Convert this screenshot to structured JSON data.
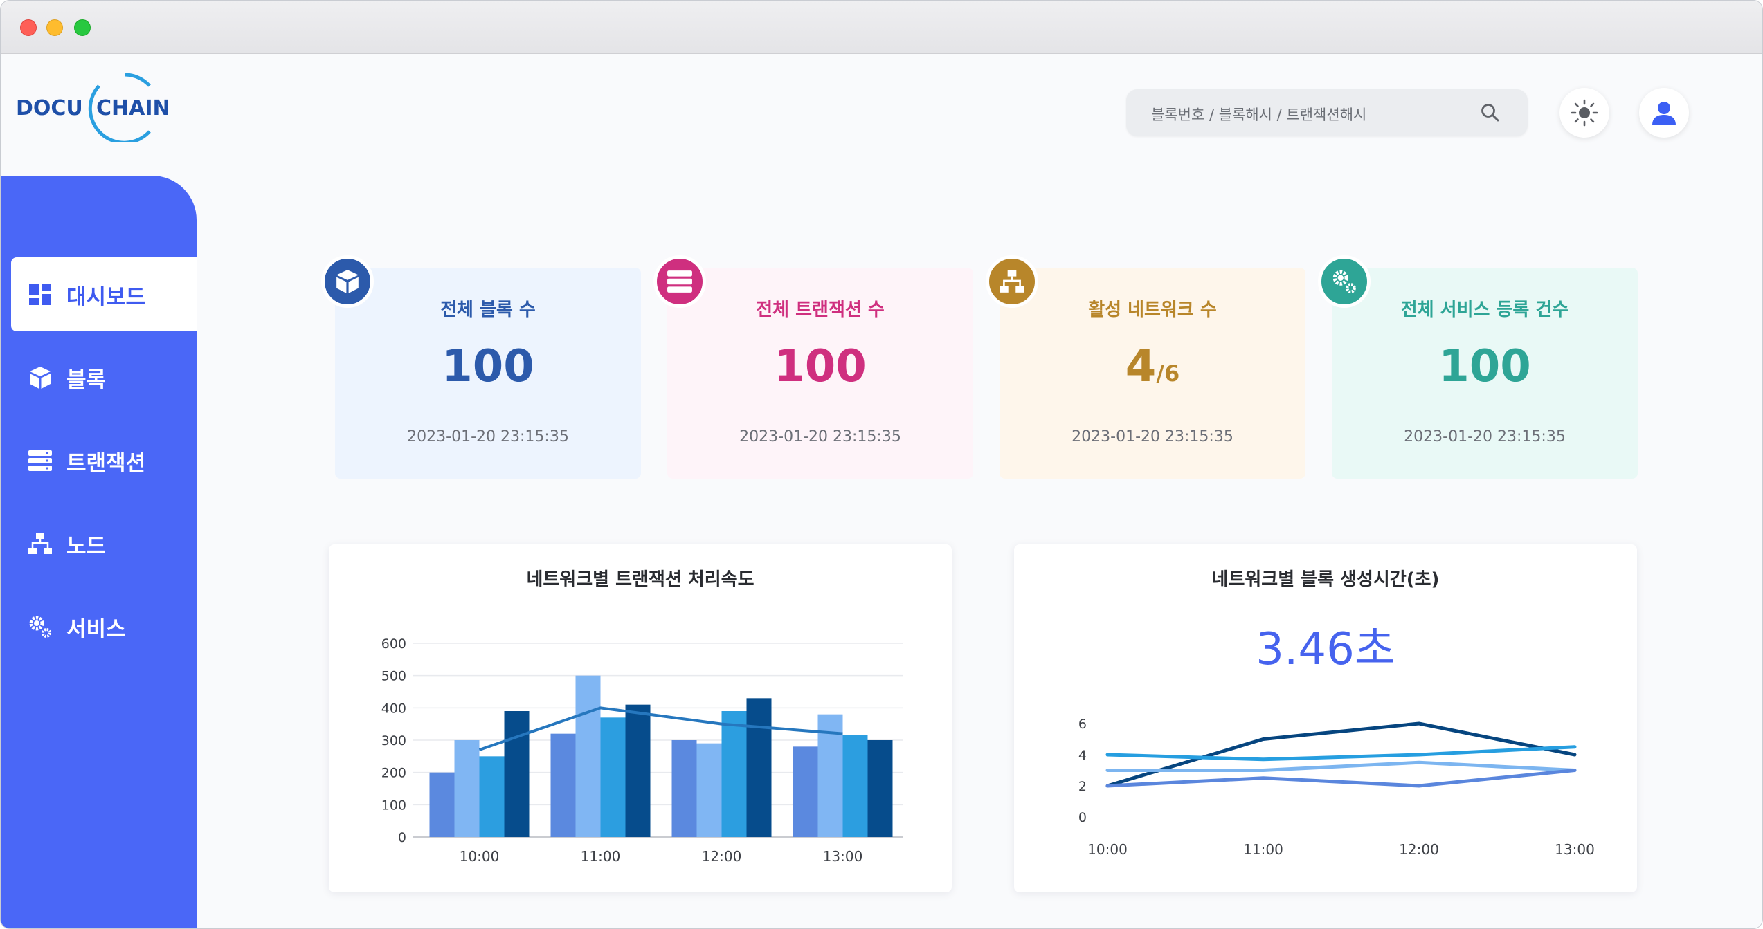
{
  "app": {
    "logo_left": "DOCU",
    "logo_right": "CHAIN"
  },
  "header": {
    "search_placeholder": "블록번호 / 블록해시 / 트랜잭션해시",
    "icons": [
      "search-icon",
      "sun-icon",
      "user-icon"
    ]
  },
  "sidebar": {
    "items": [
      {
        "label": "대시보드",
        "icon": "dashboard-icon",
        "active": true
      },
      {
        "label": "블록",
        "icon": "cube-icon",
        "active": false
      },
      {
        "label": "트랜잭션",
        "icon": "server-icon",
        "active": false
      },
      {
        "label": "노드",
        "icon": "network-icon",
        "active": false
      },
      {
        "label": "서비스",
        "icon": "gears-icon",
        "active": false
      }
    ]
  },
  "stats": [
    {
      "title": "전체 블록 수",
      "value": "100",
      "time": "2023-01-20 23:15:35",
      "color": "#2c5aab",
      "bg": "#edf4fe",
      "icon": "cube-icon"
    },
    {
      "title": "전체 트랜잭션 수",
      "value": "100",
      "time": "2023-01-20 23:15:35",
      "color": "#cf2f7f",
      "bg": "#fef4f9",
      "icon": "server-icon"
    },
    {
      "title": "활성 네트워크 수",
      "value": "4",
      "value_sub": "/6",
      "time": "2023-01-20 23:15:35",
      "color": "#b8862a",
      "bg": "#fef6eb",
      "icon": "network-icon"
    },
    {
      "title": "전체 서비스 등록 건수",
      "value": "100",
      "time": "2023-01-20 23:15:35",
      "color": "#2ea596",
      "bg": "#e9f9f6",
      "icon": "gears-icon"
    }
  ],
  "chart_data": [
    {
      "type": "bar",
      "title": "네트워크별 트랜잭션 처리속도",
      "categories": [
        "10:00",
        "11:00",
        "12:00",
        "13:00"
      ],
      "ylim": [
        0,
        600
      ],
      "yticks": [
        0,
        100,
        200,
        300,
        400,
        500,
        600
      ],
      "series": [
        {
          "values": [
            200,
            320,
            300,
            280
          ],
          "color": "#5b89df"
        },
        {
          "values": [
            300,
            500,
            290,
            380
          ],
          "color": "#80b6f3"
        },
        {
          "values": [
            250,
            370,
            390,
            315
          ],
          "color": "#2c9ee0"
        },
        {
          "values": [
            390,
            410,
            430,
            300
          ],
          "color": "#064c8c"
        }
      ],
      "line": {
        "values": [
          270,
          400,
          350,
          320
        ],
        "color": "#2677be"
      },
      "grid": true
    },
    {
      "type": "line",
      "title": "네트워크별 블록 생성시간(초)",
      "headline": "3.46초",
      "x": [
        "10:00",
        "11:00",
        "12:00",
        "13:00"
      ],
      "ylim": [
        0,
        6
      ],
      "yticks": [
        0,
        2,
        4,
        6
      ],
      "series": [
        {
          "values": [
            2.0,
            5.0,
            6.0,
            4.0
          ],
          "color": "#06457f"
        },
        {
          "values": [
            4.0,
            3.7,
            4.0,
            4.5
          ],
          "color": "#269ee0"
        },
        {
          "values": [
            3.0,
            3.0,
            3.5,
            3.0
          ],
          "color": "#7cb5f0"
        },
        {
          "values": [
            2.0,
            2.5,
            2.0,
            3.0
          ],
          "color": "#5a86dd"
        }
      ],
      "grid": false
    }
  ]
}
